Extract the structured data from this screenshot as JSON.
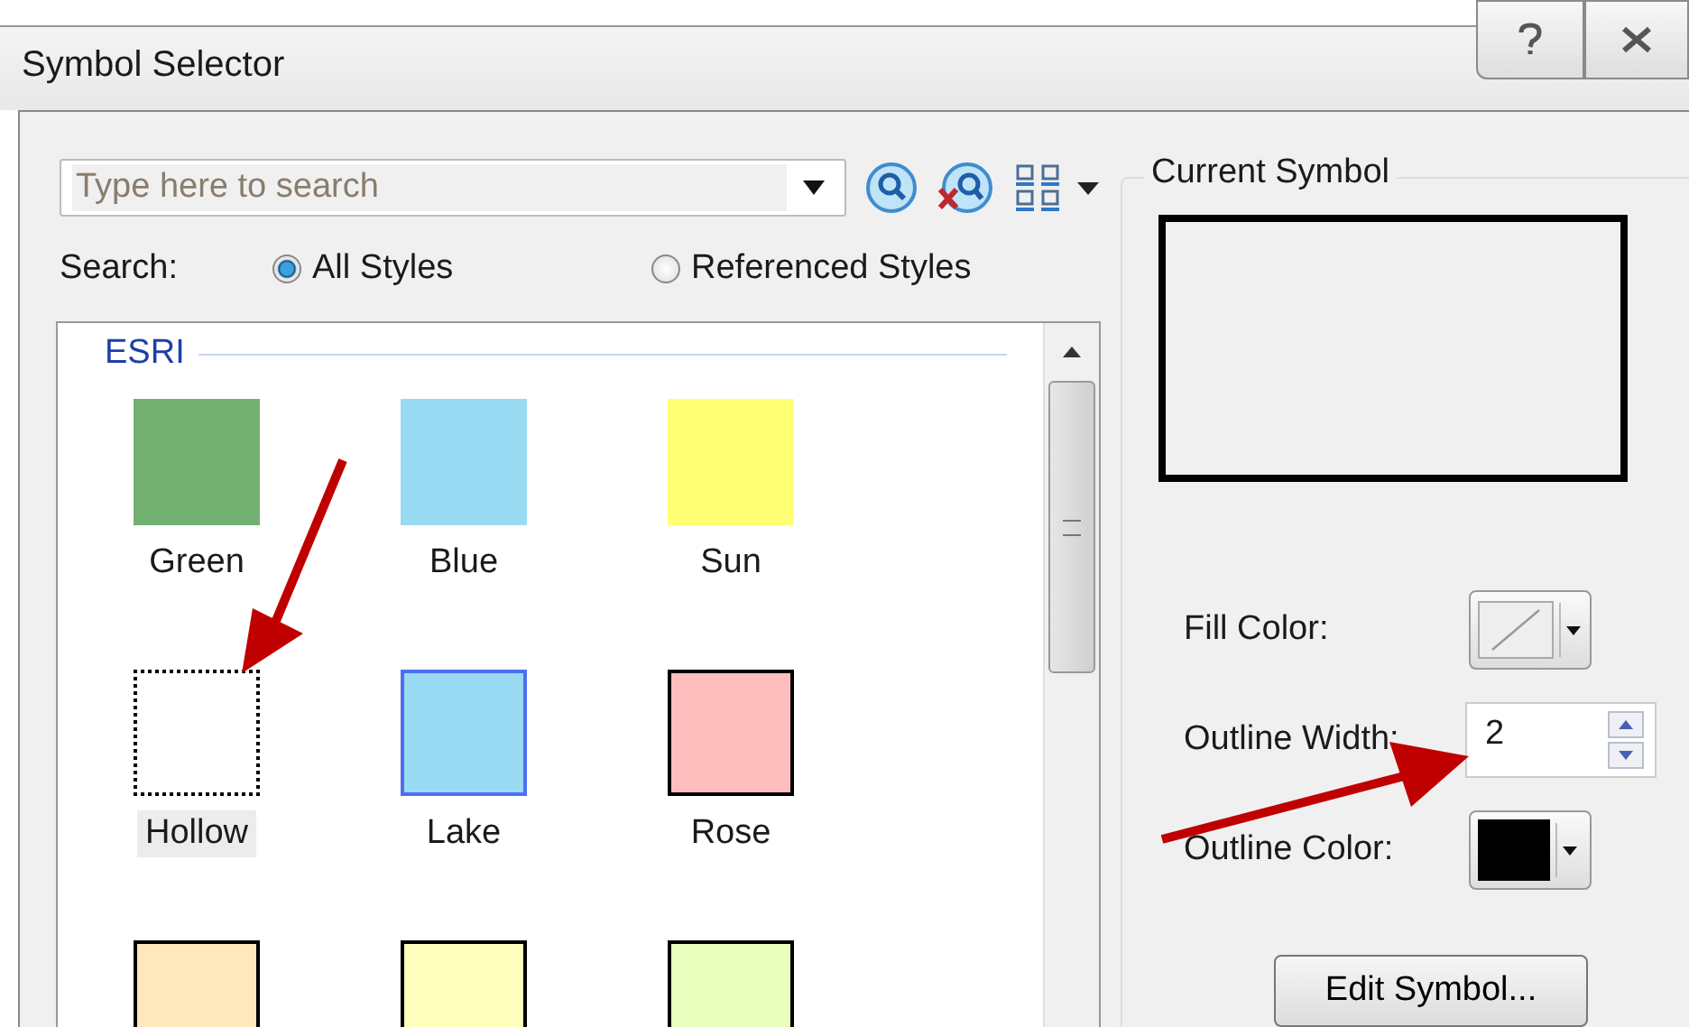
{
  "window": {
    "title": "Symbol Selector"
  },
  "search": {
    "placeholder": "Type here to search",
    "label": "Search:",
    "scopes": [
      {
        "label": "All Styles",
        "selected": true
      },
      {
        "label": "Referenced Styles",
        "selected": false
      }
    ]
  },
  "gallery": {
    "group": "ESRI",
    "symbols": [
      {
        "label": "Green",
        "color": "#72b072",
        "kind": "plain",
        "selected": false
      },
      {
        "label": "Blue",
        "color": "#99dbf2",
        "kind": "plain",
        "selected": false
      },
      {
        "label": "Sun",
        "color": "#ffff73",
        "kind": "plain",
        "selected": false
      },
      {
        "label": "Hollow",
        "color": "#ffffff",
        "kind": "plain",
        "selected": true
      },
      {
        "label": "Lake",
        "color": "#99dbf2",
        "kind": "blueline",
        "selected": false
      },
      {
        "label": "Rose",
        "color": "#ffbebe",
        "kind": "outlined",
        "selected": false
      },
      {
        "color": "#ffe8be",
        "kind": "outlined",
        "selected": false
      },
      {
        "color": "#ffffbe",
        "kind": "outlined",
        "selected": false
      },
      {
        "color": "#e9ffbe",
        "kind": "outlined",
        "selected": false
      }
    ]
  },
  "current_symbol": {
    "title": "Current Symbol",
    "fill_label": "Fill Color:",
    "width_label": "Outline Width:",
    "width_value": "2",
    "outline_label": "Outline Color:",
    "edit_button": "Edit Symbol..."
  }
}
